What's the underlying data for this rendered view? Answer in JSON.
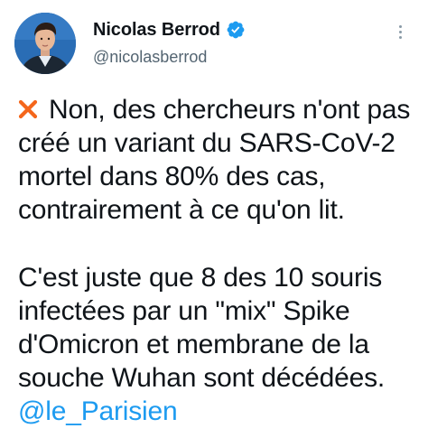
{
  "author": {
    "display_name": "Nicolas Berrod",
    "handle": "@nicolasberrod",
    "verified": true,
    "avatar_icon": "person-portrait"
  },
  "tweet": {
    "lead_icon": "cross-mark-icon",
    "paragraph_1": "Non, des chercheurs n'ont pas créé un variant du SARS-CoV-2 mortel dans 80% des cas, contrairement à ce qu'on lit.",
    "paragraph_2": "C'est juste que 8 des 10 souris infectées par un \"mix\" Spike d'Omicron et membrane de la souche Wuhan sont décédées.",
    "mention": "@le_Parisien"
  },
  "colors": {
    "text": "#0f1419",
    "secondary": "#536471",
    "accent": "#1d9bf0",
    "cross": "#f4661b"
  }
}
